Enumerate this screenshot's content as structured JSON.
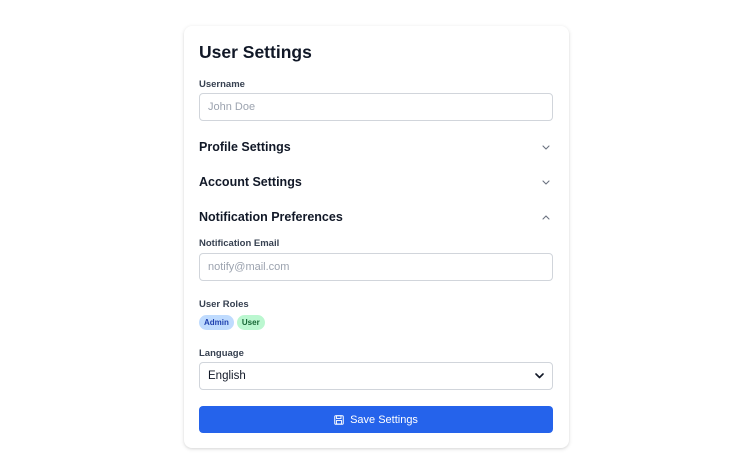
{
  "header": {
    "title": "User Settings"
  },
  "username": {
    "label": "Username",
    "placeholder": "John Doe",
    "value": ""
  },
  "sections": [
    {
      "title": "Profile Settings",
      "expanded": false,
      "icon": "chevron-down-icon"
    },
    {
      "title": "Account Settings",
      "expanded": false,
      "icon": "chevron-down-icon"
    },
    {
      "title": "Notification Preferences",
      "expanded": true,
      "icon": "chevron-up-icon"
    }
  ],
  "notification": {
    "email_label": "Notification Email",
    "email_placeholder": "notify@mail.com",
    "email_value": ""
  },
  "roles": {
    "label": "User Roles",
    "items": [
      {
        "name": "Admin",
        "color": "#bfdbfe"
      },
      {
        "name": "User",
        "color": "#bbf7d0"
      }
    ]
  },
  "language": {
    "label": "Language",
    "selected": "English"
  },
  "actions": {
    "save_label": "Save Settings",
    "save_icon": "save-icon",
    "accent_color": "#2563eb"
  }
}
